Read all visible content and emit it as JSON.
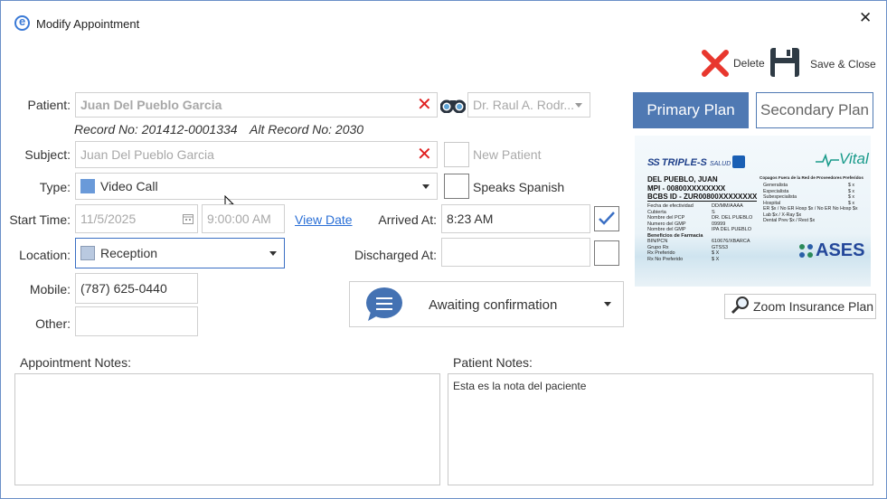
{
  "window": {
    "title": "Modify Appointment",
    "close_label": "✕"
  },
  "toolbar": {
    "delete_label": "Delete",
    "save_close_label": "Save & Close"
  },
  "labels": {
    "patient": "Patient:",
    "subject": "Subject:",
    "type": "Type:",
    "start_time": "Start Time:",
    "location": "Location:",
    "mobile": "Mobile:",
    "other": "Other:",
    "arrived_at": "Arrived At:",
    "discharged_at": "Discharged At:",
    "appointment_notes": "Appointment Notes:",
    "patient_notes": "Patient Notes:"
  },
  "patient": {
    "name": "Juan Del Pueblo Garcia",
    "record_no": "Record No: 201412-0001334",
    "alt_record_no": "Alt Record No: 2030",
    "doctor": "Dr. Raul A. Rodr..."
  },
  "subject": {
    "value": "Juan Del Pueblo Garcia",
    "new_patient_label": "New Patient"
  },
  "type": {
    "value": "Video Call",
    "color": "#6a9ad9",
    "speaks_spanish_label": "Speaks Spanish"
  },
  "start": {
    "date": "11/5/2025",
    "time": "9:00:00 AM",
    "view_date_label": "View Date"
  },
  "arrived": {
    "value": "8:23 AM",
    "checked": true
  },
  "discharged": {
    "value": "",
    "checked": false
  },
  "location": {
    "value": "Reception",
    "color": "#b9c9e0"
  },
  "mobile": {
    "value": "(787) 625-0440"
  },
  "other": {
    "value": ""
  },
  "status": {
    "label": "Awaiting confirmation"
  },
  "plans": {
    "primary_label": "Primary Plan",
    "secondary_label": "Secondary Plan",
    "zoom_label": "Zoom Insurance Plan"
  },
  "notes": {
    "appointment": "",
    "patient": "Esta es la nota del paciente"
  },
  "card": {
    "brand": "TRIPLE-S",
    "brand_sub": "SALUD",
    "vital": "Vital",
    "holder": "DEL PUEBLO, JUAN",
    "mpi": "MPI - 00800XXXXXXXX",
    "bcbs": "BCBS ID - ZUR00800XXXXXXXX",
    "rows_left": [
      "Fecha de efectividad",
      "Cubierta",
      "Nombre del PCP",
      "Numero del GMP",
      "Nombre del GMP",
      "Beneficios de Farmacia",
      "BIN/PCN",
      "Grupo Rx",
      "Rx Preferido",
      "Rx No Preferido"
    ],
    "rows_mid": [
      "DD/MM/AAAA",
      "S",
      "DR. DEL PUEBLO",
      "09999",
      "IPA DEL PUEBLO",
      "",
      "610676/XBARCA",
      "GTSS3",
      "$ X",
      "$ X"
    ],
    "copay_title": "Copagos Fuera de la Red de Proveedores Preferidos",
    "copay_rows": [
      "Generalista",
      "Especialista",
      "Subespecialista",
      "Hospital",
      "ER $x / No ER Hosp $x / No ER No Hosp $x",
      "Lab $x / X-Ray $x",
      "Dental Prev $x / Rest $x"
    ],
    "copay_vals": [
      "$ x",
      "$ x",
      "$ x",
      "$ x",
      "",
      "",
      ""
    ],
    "ases": "ASES"
  }
}
